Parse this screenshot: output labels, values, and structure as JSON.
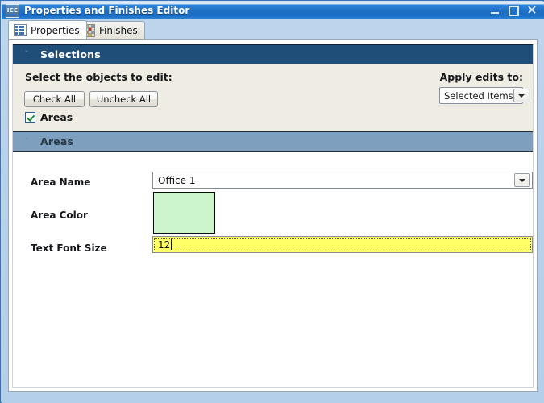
{
  "window": {
    "title": "Properties and Finishes Editor",
    "app_icon": "ICE",
    "controls": {
      "minimize": "minimize-icon",
      "maximize": "maximize-icon",
      "close": "close-icon"
    }
  },
  "tabs": [
    {
      "label": "Properties",
      "icon": "list-details-icon",
      "selected": true
    },
    {
      "label": "Finishes",
      "icon": "color-palette-icon",
      "selected": false
    }
  ],
  "sections": {
    "selections": {
      "title": "Selections",
      "chevron": "chevron-down-icon",
      "prompt": "Select the objects to edit:",
      "check_all": "Check All",
      "uncheck_all": "Uncheck All",
      "apply_label": "Apply edits to:",
      "apply_value": "Selected Items",
      "apply_options": [
        "Selected Items"
      ],
      "objects": [
        {
          "label": "Areas",
          "checked": true
        }
      ]
    },
    "areas": {
      "title": "Areas",
      "chevron": "chevron-down-icon",
      "fields": {
        "area_name_label": "Area Name",
        "area_name_value": "Office 1",
        "area_color_label": "Area Color",
        "area_color_value": "#CCF5CC",
        "text_font_size_label": "Text Font Size",
        "text_font_size_value": "12"
      }
    }
  },
  "colors": {
    "titlebar_blue": "#1F6FC4",
    "section_header_dark": "#1F4E79",
    "section_header_light": "#7E9FBD",
    "selections_body": "#EFECE3",
    "area_color_swatch": "#CCF5CC",
    "focused_input": "#FFFF66"
  }
}
